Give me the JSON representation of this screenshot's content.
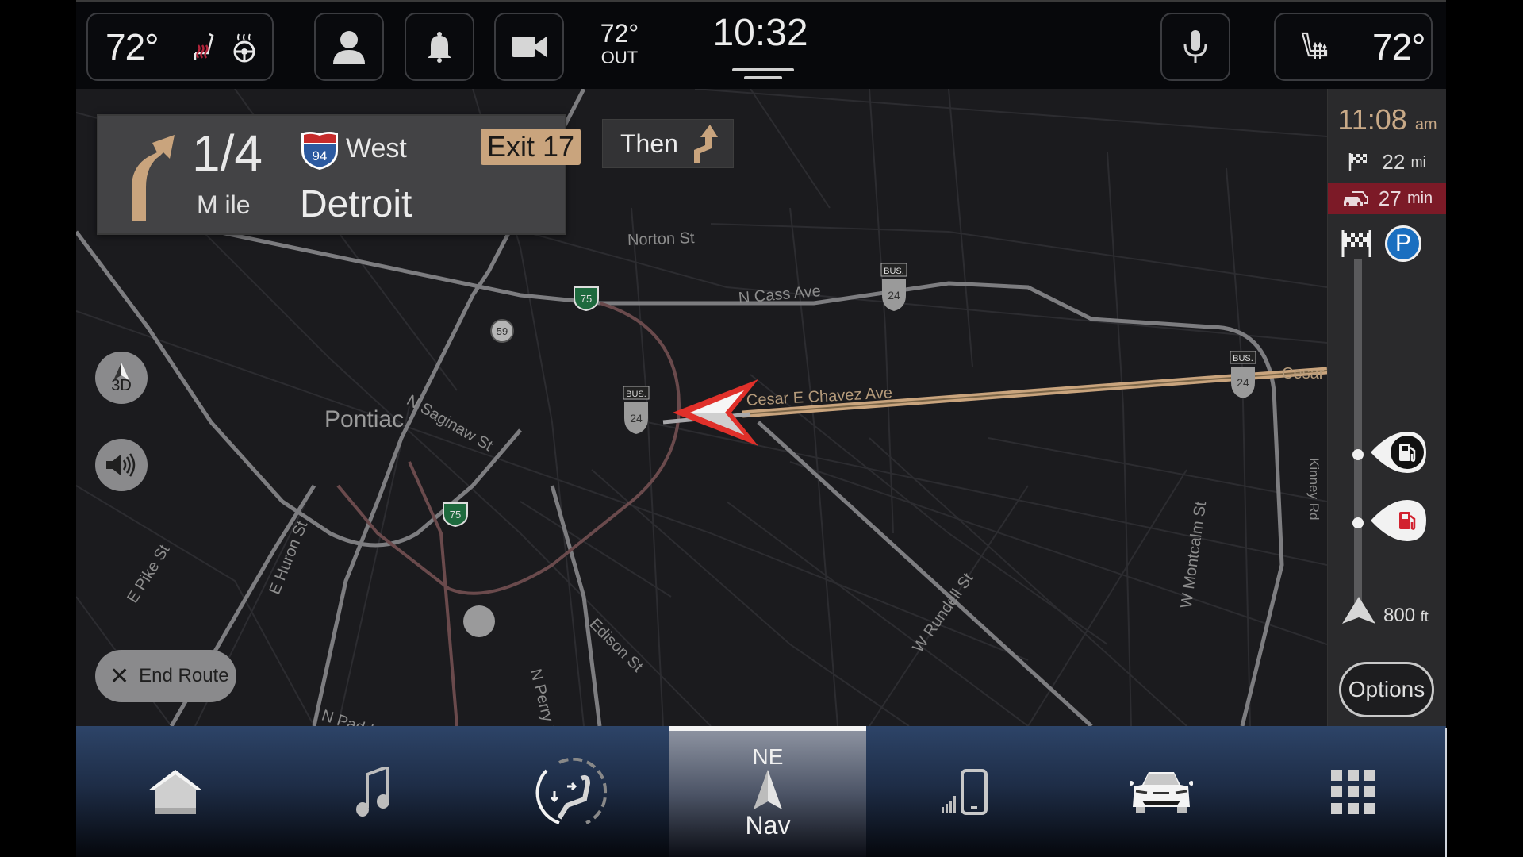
{
  "topbar": {
    "driver_temp": "72°",
    "passenger_temp": "72°",
    "outside_temp": "72°",
    "outside_label": "OUT",
    "clock": "10:32",
    "icons": {
      "driver_seat_heat": "heated-seat-icon",
      "steering_heat": "heated-steering-wheel-icon",
      "profile": "user-profile-icon",
      "notifications": "bell-icon",
      "camera": "video-camera-icon",
      "voice": "microphone-icon",
      "passenger_seat": "seat-climate-icon"
    },
    "colors": {
      "seat_heat_active": "#b0243a"
    }
  },
  "guidance": {
    "distance": "1/4",
    "distance_unit": "M ile",
    "highway_number": "94",
    "highway_direction": "West",
    "destination_city": "Detroit",
    "exit_label": "Exit 17",
    "then_label": "Then",
    "maneuver_icon": "bear-right-arrow-icon",
    "next_maneuver_icon": "keep-right-arrow-icon",
    "colors": {
      "maneuver": "#c9a47d",
      "exit_badge": "#c9a47d"
    }
  },
  "map": {
    "city_label": "Pontiac",
    "streets": [
      "Norton St",
      "N Cass Ave",
      "N Saginaw St",
      "Cesar E Chavez Ave",
      "Cesar",
      "E Huron St",
      "E Pike St",
      "N Perry St",
      "Edison St",
      "N Paddock St",
      "W Rundell St",
      "W Montcalm St",
      "Kinney Rd"
    ],
    "shields": {
      "interstate_75": "75",
      "state_59": "59",
      "business_24": "24",
      "business_label": "BUS."
    },
    "view_mode_label": "3D",
    "end_route_label": "End Route",
    "colors": {
      "route": "#c9a47d",
      "vehicle_arrow": "#e0302a"
    }
  },
  "route_panel": {
    "eta_time": "11:08",
    "eta_ampm": "am",
    "remaining_distance": "22",
    "remaining_distance_unit": "mi",
    "remaining_time": "27",
    "remaining_time_unit": "min",
    "ahead_distance": "800",
    "ahead_distance_unit": "ft",
    "parking_label": "P",
    "options_label": "Options",
    "stops": [
      {
        "type": "fuel",
        "icon": "fuel-pump-icon",
        "style": "dark"
      },
      {
        "type": "fuel",
        "icon": "fuel-pump-icon",
        "style": "red"
      }
    ],
    "colors": {
      "eta": "#c8a987",
      "traffic_delay_bg": "#7c1a27",
      "parking": "#1a6fc0"
    }
  },
  "bottom_nav": {
    "items": [
      {
        "id": "home",
        "icon": "home-icon",
        "label": ""
      },
      {
        "id": "media",
        "icon": "music-note-icon",
        "label": ""
      },
      {
        "id": "comfort",
        "icon": "seat-comfort-icon",
        "label": ""
      },
      {
        "id": "nav",
        "icon": "compass-arrow-icon",
        "label": "Nav",
        "heading": "NE",
        "active": true
      },
      {
        "id": "phone",
        "icon": "phone-signal-icon",
        "label": ""
      },
      {
        "id": "vehicle",
        "icon": "car-icon",
        "label": ""
      },
      {
        "id": "apps",
        "icon": "app-grid-icon",
        "label": ""
      }
    ]
  }
}
